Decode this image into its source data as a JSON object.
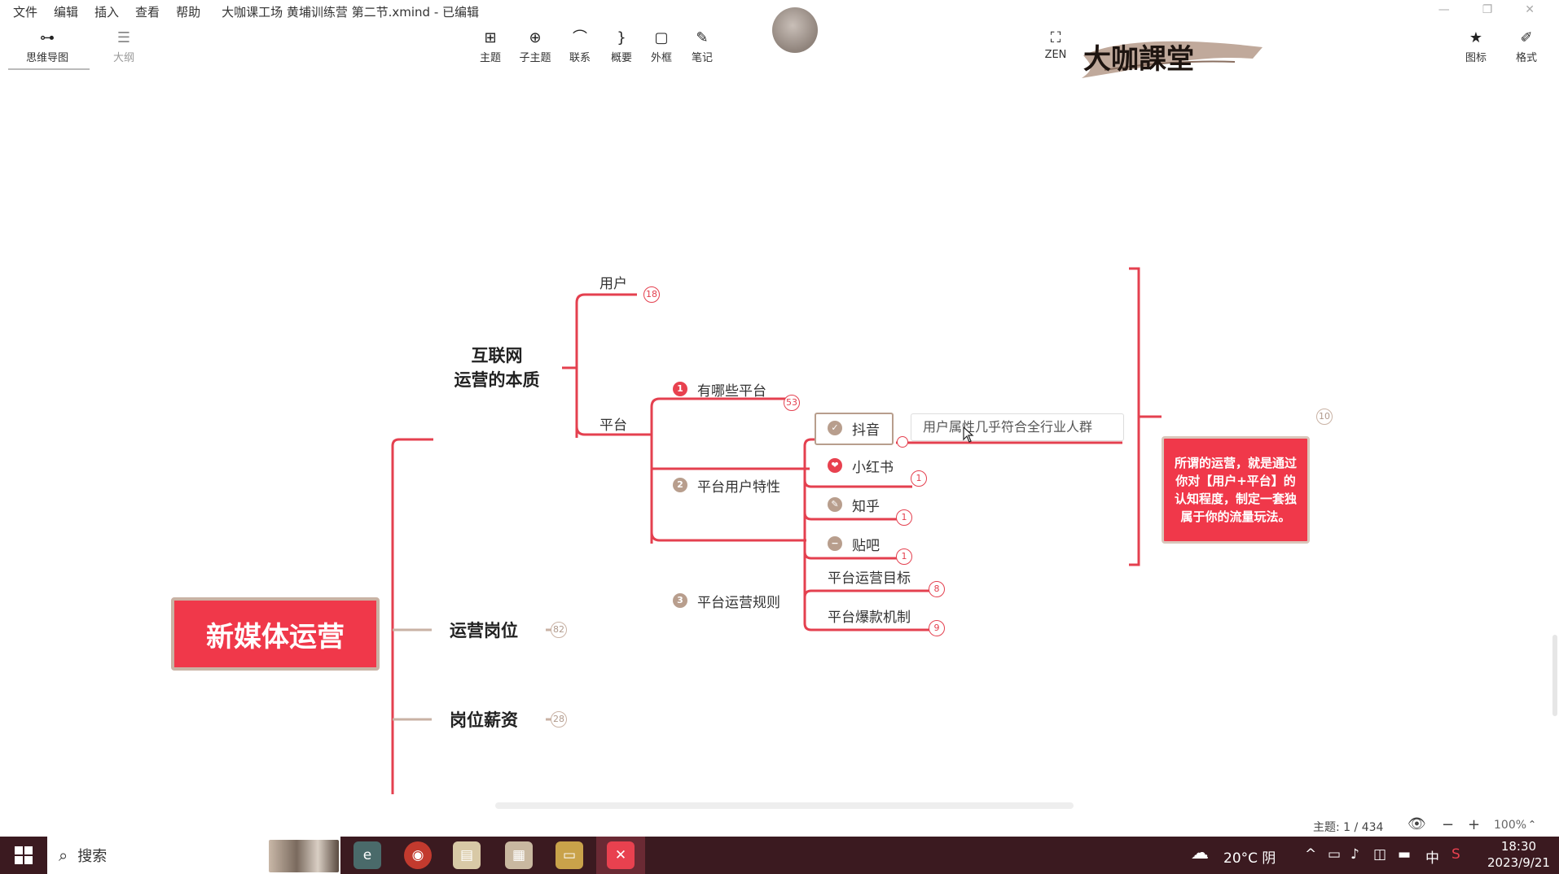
{
  "app": {
    "menu": [
      "文件",
      "编辑",
      "插入",
      "查看",
      "帮助"
    ],
    "doc_title": "大咖课工场 黄埔训练营 第二节.xmind - 已编辑",
    "logo_text": "大咖課堂"
  },
  "toolbar": {
    "left": [
      {
        "label": "思维导图",
        "icon": "mindmap-icon"
      },
      {
        "label": "大纲",
        "icon": "outline-icon"
      }
    ],
    "center": [
      {
        "label": "主题",
        "icon": "topic-icon"
      },
      {
        "label": "子主题",
        "icon": "subtopic-icon"
      },
      {
        "label": "联系",
        "icon": "relationship-icon"
      },
      {
        "label": "概要",
        "icon": "summary-icon"
      },
      {
        "label": "外框",
        "icon": "boundary-icon"
      },
      {
        "label": "笔记",
        "icon": "note-icon"
      }
    ],
    "zen": {
      "label": "ZEN",
      "icon": "zen-icon"
    },
    "right": [
      {
        "label": "图标",
        "icon": "star-icon"
      },
      {
        "label": "格式",
        "icon": "format-icon"
      }
    ]
  },
  "mindmap": {
    "central": "新媒体运营",
    "branch1": {
      "line1": "互联网",
      "line2": "运营的本质"
    },
    "users": {
      "label": "用户",
      "count": "18"
    },
    "platform": {
      "label": "平台"
    },
    "which_platforms": {
      "marker": "1",
      "label": "有哪些平台",
      "count": "53"
    },
    "user_traits": {
      "marker": "2",
      "label": "平台用户特性"
    },
    "ops_rules": {
      "marker": "3",
      "label": "平台运营规则"
    },
    "douyin": {
      "label": "抖音",
      "note": "用户属性几乎符合全行业人群"
    },
    "xiaohongshu": {
      "label": "小红书",
      "count": "1"
    },
    "zhihu": {
      "label": "知乎",
      "count": "1"
    },
    "tieba": {
      "label": "贴吧",
      "count": "1"
    },
    "ops_goal": {
      "label": "平台运营目标",
      "count": "8"
    },
    "viral": {
      "label": "平台爆款机制",
      "count": "9"
    },
    "summary": {
      "text": "所谓的运营，就是通过你对【用户+平台】的认知程度，制定一套独属于你的流量玩法。",
      "count": "10"
    },
    "branch2": {
      "label": "运营岗位",
      "count": "82"
    },
    "branch3": {
      "label": "岗位薪资",
      "count": "28"
    }
  },
  "status": {
    "topics": "主题: 1 / 434",
    "zoom": "100%"
  },
  "taskbar": {
    "search": "搜索",
    "weather": "20°C 阴",
    "ime": "中",
    "time": "18:30",
    "date": "2023/9/21"
  },
  "colors": {
    "accent": "#f0384a",
    "line": "#e4404f",
    "tan": "#c9b2a4",
    "taskbar": "#3b1a20"
  }
}
